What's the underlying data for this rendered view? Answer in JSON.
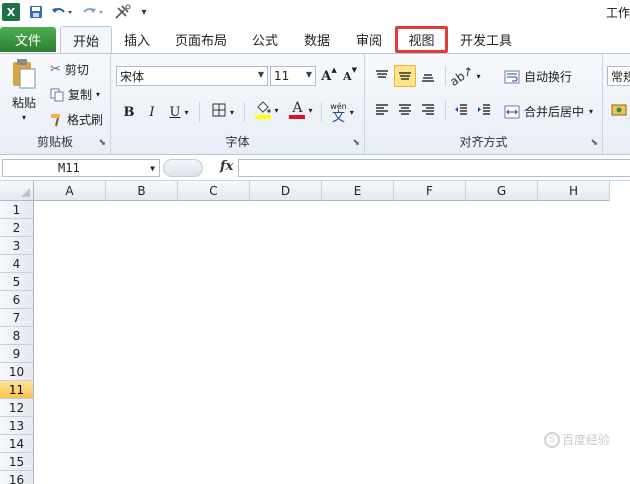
{
  "title": "工作",
  "quick_access": {
    "logo": "excel-logo-icon",
    "save": "save-icon",
    "undo": "undo-icon",
    "redo": "redo-icon",
    "customize": "customize-icon"
  },
  "tabs": {
    "file": "文件",
    "items": [
      "开始",
      "插入",
      "页面布局",
      "公式",
      "数据",
      "审阅",
      "视图",
      "开发工具"
    ],
    "active": "开始",
    "highlighted": "视图"
  },
  "ribbon": {
    "clipboard": {
      "label": "剪贴板",
      "paste": "粘贴",
      "cut": "剪切",
      "copy": "复制",
      "format_painter": "格式刷"
    },
    "font": {
      "label": "字体",
      "font_name": "宋体",
      "font_size": "11",
      "bold": "B",
      "italic": "I",
      "underline": "U",
      "phonetic": "wén",
      "phonetic_char": "文",
      "increase": "A",
      "decrease": "A",
      "font_color": "A"
    },
    "alignment": {
      "label": "对齐方式",
      "wrap_text": "自动换行",
      "merge_center": "合并后居中"
    },
    "number": {
      "format": "常规"
    }
  },
  "formula_bar": {
    "name_box": "M11",
    "fx": "fx",
    "value": ""
  },
  "grid": {
    "columns": [
      "A",
      "B",
      "C",
      "D",
      "E",
      "F",
      "G",
      "H"
    ],
    "rows": [
      "1",
      "2",
      "3",
      "4",
      "5",
      "6",
      "7",
      "8",
      "9",
      "10",
      "11",
      "12",
      "13",
      "14",
      "15",
      "16"
    ],
    "selected_row": "11"
  },
  "watermark": "百度经验",
  "colors": {
    "file_tab": "#2e7d32",
    "highlight_box": "#e53935",
    "selected_row": "#f8c34c",
    "ribbon_bg": "#e8eef6"
  }
}
